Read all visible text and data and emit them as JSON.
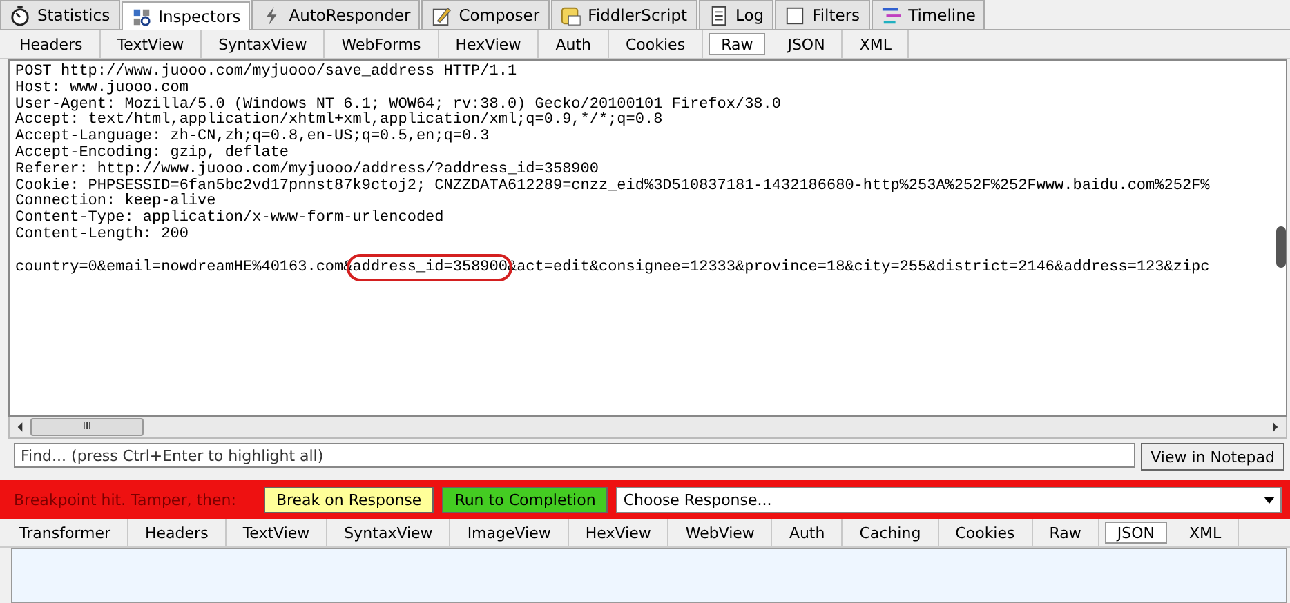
{
  "main_tabs": [
    {
      "label": "Statistics",
      "selected": false
    },
    {
      "label": "Inspectors",
      "selected": true
    },
    {
      "label": "AutoResponder",
      "selected": false
    },
    {
      "label": "Composer",
      "selected": false
    },
    {
      "label": "FiddlerScript",
      "selected": false
    },
    {
      "label": "Log",
      "selected": false
    },
    {
      "label": "Filters",
      "selected": false
    },
    {
      "label": "Timeline",
      "selected": false
    }
  ],
  "request_tabs": [
    {
      "label": "Headers",
      "selected": false
    },
    {
      "label": "TextView",
      "selected": false
    },
    {
      "label": "SyntaxView",
      "selected": false
    },
    {
      "label": "WebForms",
      "selected": false
    },
    {
      "label": "HexView",
      "selected": false
    },
    {
      "label": "Auth",
      "selected": false
    },
    {
      "label": "Cookies",
      "selected": false
    },
    {
      "label": "Raw",
      "selected": true
    },
    {
      "label": "JSON",
      "selected": false
    },
    {
      "label": "XML",
      "selected": false
    }
  ],
  "request_lines": [
    "POST http://www.juooo.com/myjuooo/save_address HTTP/1.1",
    "Host: www.juooo.com",
    "User-Agent: Mozilla/5.0 (Windows NT 6.1; WOW64; rv:38.0) Gecko/20100101 Firefox/38.0",
    "Accept: text/html,application/xhtml+xml,application/xml;q=0.9,*/*;q=0.8",
    "Accept-Language: zh-CN,zh;q=0.8,en-US;q=0.5,en;q=0.3",
    "Accept-Encoding: gzip, deflate",
    "Referer: http://www.juooo.com/myjuooo/address/?address_id=358900",
    "Cookie: PHPSESSID=6fan5bc2vd17pnnst87k9ctoj2; CNZZDATA612289=cnzz_eid%3D510837181-1432186680-http%253A%252F%252Fwww.baidu.com%252F%",
    "Connection: keep-alive",
    "Content-Type: application/x-www-form-urlencoded",
    "Content-Length: 200"
  ],
  "request_body": {
    "before": "country=0&email=nowdreamHE%40163.com&",
    "highlighted": "address_id=358900",
    "after": "&act=edit&consignee=12333&province=18&city=255&district=2146&address=123&zipc"
  },
  "scroll_thumb_glyph": "III",
  "find": {
    "placeholder": "Find... (press Ctrl+Enter to highlight all)"
  },
  "notepad_button": "View in Notepad",
  "breakpoint_bar": {
    "message": "Breakpoint hit. Tamper, then:",
    "break_button": "Break on Response",
    "run_button": "Run to Completion",
    "response_select": "Choose Response..."
  },
  "response_tabs": [
    {
      "label": "Transformer",
      "selected": false
    },
    {
      "label": "Headers",
      "selected": false
    },
    {
      "label": "TextView",
      "selected": false
    },
    {
      "label": "SyntaxView",
      "selected": false
    },
    {
      "label": "ImageView",
      "selected": false
    },
    {
      "label": "HexView",
      "selected": false
    },
    {
      "label": "WebView",
      "selected": false
    },
    {
      "label": "Auth",
      "selected": false
    },
    {
      "label": "Caching",
      "selected": false
    },
    {
      "label": "Cookies",
      "selected": false
    },
    {
      "label": "Raw",
      "selected": false
    },
    {
      "label": "JSON",
      "selected": true
    },
    {
      "label": "XML",
      "selected": false
    }
  ]
}
